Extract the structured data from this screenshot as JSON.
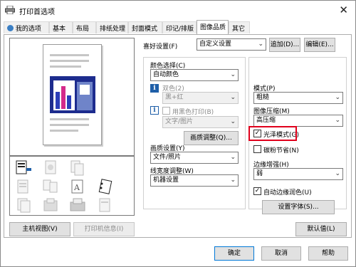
{
  "window": {
    "title": "打印首选项"
  },
  "tabs": [
    {
      "label": "我的选项"
    },
    {
      "label": "基本"
    },
    {
      "label": "布局"
    },
    {
      "label": "排纸处理"
    },
    {
      "label": "封面模式"
    },
    {
      "label": "印记/排版"
    },
    {
      "label": "图像品质",
      "active": true
    },
    {
      "label": "其它"
    }
  ],
  "favorite": {
    "label": "喜好设置(F)",
    "value": "自定义设置",
    "add_button": "追加(D)...",
    "edit_button": "编辑(E)..."
  },
  "left_buttons": {
    "main_view": "主机视图(V)",
    "printer_info": "打印机信息(I)"
  },
  "color": {
    "label": "颜色选择(C)",
    "value": "自动颜色",
    "dual_label": "双色(2)",
    "dual_value": "黑+红",
    "black_print_label": "用黑色打印(B)",
    "black_print_value": "文字/图片",
    "quality_button": "画质调整(Q)..."
  },
  "image_quality": {
    "label": "画质设置(Y)",
    "value": "文件/照片"
  },
  "line_width": {
    "label": "线宽度调整(W)",
    "value": "机器设置"
  },
  "mode": {
    "label": "模式(P)",
    "value": "粗糙"
  },
  "compression": {
    "label": "图像压缩(M)",
    "value": "高压缩"
  },
  "gloss": {
    "label": "光泽模式(G)",
    "checked": true
  },
  "toner_save": {
    "label": "碳粉节省(N)",
    "checked": false
  },
  "edge_enhance": {
    "label": "边缘增强(H)",
    "value": "弱"
  },
  "auto_trap": {
    "label": "自动边缘润色(U)",
    "checked": true
  },
  "font_settings_button": "设置字体(S)...",
  "default_button": "默认值(L)",
  "footer": {
    "ok": "确定",
    "cancel": "取消",
    "help": "帮助"
  },
  "colors": {
    "highlight": "#e0001b",
    "info_blue": "#1f5fa8"
  }
}
